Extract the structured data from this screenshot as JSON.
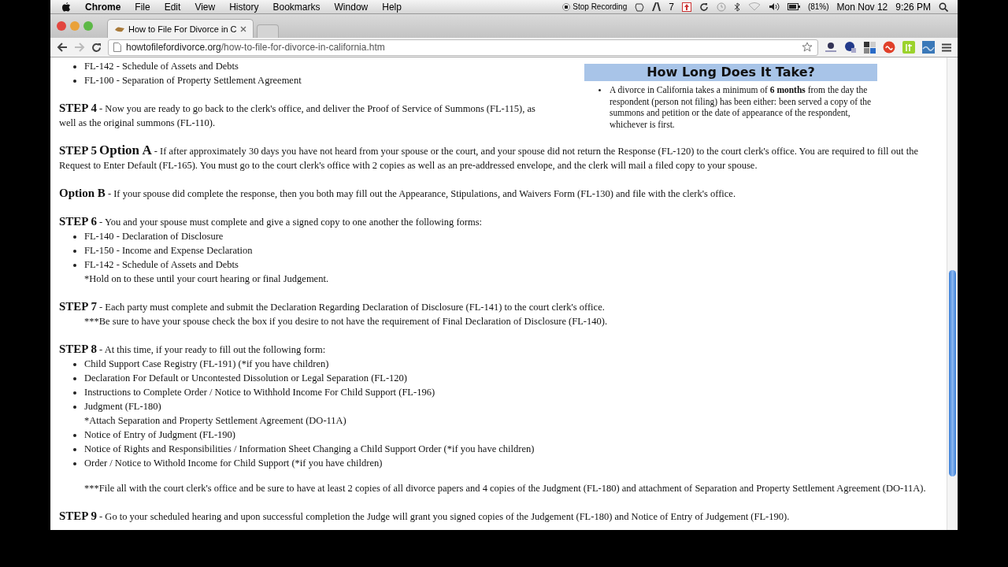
{
  "menubar": {
    "app": "Chrome",
    "menus": [
      "File",
      "Edit",
      "View",
      "History",
      "Bookmarks",
      "Window",
      "Help"
    ],
    "recording": "Stop Recording",
    "badge_count": "7",
    "battery": "(81%)",
    "date": "Mon Nov 12",
    "time": "9:26 PM"
  },
  "browser": {
    "tabs": [
      {
        "title": "How to File For Divorce in C",
        "selected": true
      }
    ],
    "url_domain": "howtofilefordivorce.org",
    "url_path": "/how-to-file-for-divorce-in-california.htm"
  },
  "page": {
    "top_items": [
      "FL-142 - Schedule of Assets and Debts",
      "FL-100 - Separation of Property Settlement Agreement"
    ],
    "sidebar": {
      "heading": "How Long Does It Take?",
      "items": [
        "A divorce in California takes a minimum of **6 months** from the day the respondent (person not filing) has been either: been served a copy of the summons and petition or the date of appearance of the respondent, whichever is first."
      ]
    },
    "steps": [
      {
        "label": "STEP 4",
        "text": "- Now you are ready to go back to the clerk's office, and deliver the Proof of Service of Summons (FL-115), as well as the original summons (FL-110)."
      },
      {
        "label": "STEP 5",
        "option": "Option A",
        "text": "- If after approximately 30 days you have not heard from your spouse or the court, and your spouse did not return the Response (FL-120) to the court clerk's office. You are required to fill out the Request to Enter Default (FL-165).  You must go to the court clerk's office with 2 copies as well as an pre-addressed envelope, and the clerk will mail a filed copy to your spouse."
      },
      {
        "label": "Option B",
        "text": "- If your spouse did complete the response, then you both may fill out the Appearance, Stipulations, and Waivers Form (FL-130) and file with the clerk's office."
      },
      {
        "label": "STEP 6",
        "text": "- You and your spouse must complete and give a signed copy to one another the following forms:",
        "items": [
          {
            "text": "FL-140 - Declaration of Disclosure"
          },
          {
            "text": "FL-150 - Income and Expense Declaration"
          },
          {
            "text": "FL-142 - Schedule of Assets and Debts",
            "note": "*Hold on to these until your court hearing or final Judgement."
          }
        ]
      },
      {
        "label": "STEP 7",
        "text": "- Each party must complete and submit the Declaration Regarding Declaration of Disclosure (FL-141) to the court clerk's office.",
        "note": "***Be sure to have your spouse check the box if you desire to not have the requirement of Final Declaration of Disclosure (FL-140)."
      },
      {
        "label": "STEP 8",
        "text": "- At this time, if your ready to fill out the following form:",
        "items": [
          {
            "text": "Child Support Case Registry (FL-191) (*if you have children)"
          },
          {
            "text": "Declaration For Default or Uncontested Dissolution or Legal Separation (FL-120)"
          },
          {
            "text": "Instructions to Complete Order / Notice to Withhold Income For Child Support (FL-196)"
          },
          {
            "text": "Judgment (FL-180)",
            "note": "*Attach Separation and Property Settlement Agreement (DO-11A)"
          },
          {
            "text": "Notice of Entry of Judgment (FL-190)"
          },
          {
            "text": "Notice of Rights and Responsibilities / Information Sheet Changing a Child Support Order (*if you have children)"
          },
          {
            "text": "Order / Notice to Withold Income for Child Support (*if you have children)"
          }
        ],
        "footnote": "***File all with the court clerk's office and be sure to have at least 2 copies of all divorce papers and 4 copies of the Judgment (FL-180) and attachment of Separation and Property Settlement Agreement (DO-11A)."
      },
      {
        "label": "STEP 9",
        "text": "- Go to your scheduled hearing and upon successful completion the Judge will grant you signed copies of the Judgement (FL-180) and Notice of Entry of Judgement (FL-190)."
      }
    ]
  }
}
